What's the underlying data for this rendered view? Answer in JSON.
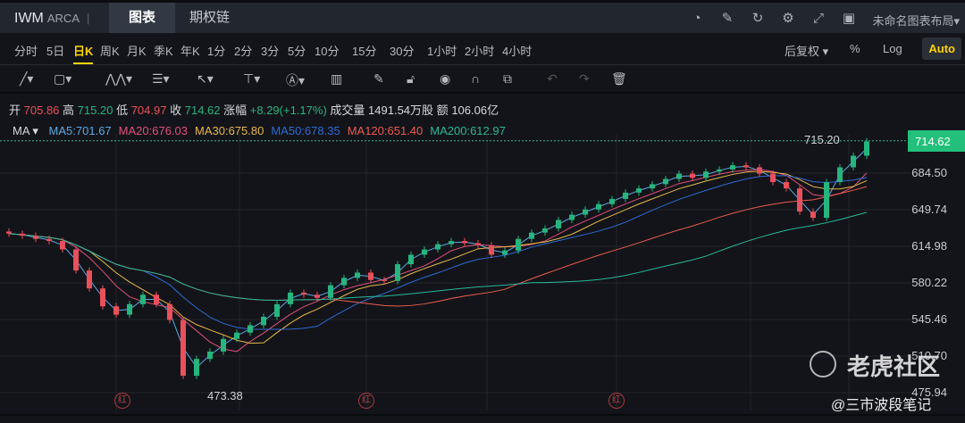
{
  "header": {
    "symbol": "IWM",
    "exchange": "ARCA",
    "separator": "|",
    "tabs": [
      "图表",
      "期权链"
    ],
    "layout_label": "未命名图表布局▾",
    "icons": [
      "speedometer-icon",
      "edit-icon",
      "refresh-icon",
      "gear-icon",
      "fullscreen-icon",
      "grid-icon"
    ]
  },
  "timeframes": {
    "items": [
      "分时",
      "5日",
      "日K",
      "周K",
      "月K",
      "季K",
      "年K",
      "1分",
      "2分",
      "3分",
      "5分",
      "10分",
      "15分",
      "30分",
      "1小时",
      "2小时",
      "4小时"
    ],
    "active": "日K",
    "adjust": "后复权 ▾",
    "percent": "%",
    "log": "Log",
    "auto": "Auto"
  },
  "toolbar": {
    "icons": [
      "line-tool-icon",
      "rectangle-tool-icon",
      "pattern-tool-icon",
      "fib-tool-icon",
      "arrow-tool-icon",
      "measure-tool-icon",
      "text-tool-icon",
      "indicator-icon",
      "pencil-icon",
      "lock-icon",
      "eye-icon",
      "magnet-icon",
      "clone-icon",
      "undo-icon",
      "redo-icon",
      "trash-icon"
    ]
  },
  "quote": {
    "open_label": "开",
    "open": "705.86",
    "high_label": "高",
    "high": "715.20",
    "low_label": "低",
    "low": "704.97",
    "close_label": "收",
    "close": "714.62",
    "change_label": "涨幅",
    "change": "+8.29(+1.17%)",
    "volume_label": "成交量",
    "volume": "1491.54万股",
    "amount_label": "额",
    "amount": "106.06亿"
  },
  "ma_legend": {
    "label": "MA ▾",
    "items": [
      {
        "text": "MA5:701.67",
        "color": "#5aa9e6"
      },
      {
        "text": "MA20:676.03",
        "color": "#e0507a"
      },
      {
        "text": "MA30:675.80",
        "color": "#e8b94a"
      },
      {
        "text": "MA50:678.35",
        "color": "#2e6bd6"
      },
      {
        "text": "MA120:651.40",
        "color": "#ec5b50"
      },
      {
        "text": "MA200:612.97",
        "color": "#28b89a"
      }
    ]
  },
  "chart_data": {
    "type": "candlestick",
    "y_ticks": [
      "684.50",
      "649.74",
      "614.98",
      "580.22",
      "545.46",
      "510.70",
      "475.94"
    ],
    "ylim": [
      470,
      720
    ],
    "last_price": "714.62",
    "high_marker": "715.20",
    "low_marker": "473.38",
    "event_marker": "红",
    "up_color": "#26b57e",
    "down_color": "#e8505b",
    "closes": [
      627,
      625,
      622,
      620,
      612,
      592,
      575,
      558,
      550,
      560,
      569,
      560,
      545,
      492,
      508,
      515,
      527,
      533,
      540,
      548,
      560,
      571,
      569,
      566,
      578,
      585,
      590,
      583,
      582,
      598,
      607,
      612,
      617,
      620,
      618,
      616,
      607,
      611,
      622,
      628,
      632,
      640,
      645,
      650,
      655,
      660,
      666,
      670,
      674,
      679,
      684,
      680,
      686,
      688,
      692,
      690,
      684,
      676,
      670,
      648,
      642,
      676,
      690,
      701,
      714.62
    ]
  },
  "watermark": {
    "brand": "老虎社区",
    "author": "@三市波段笔记"
  }
}
